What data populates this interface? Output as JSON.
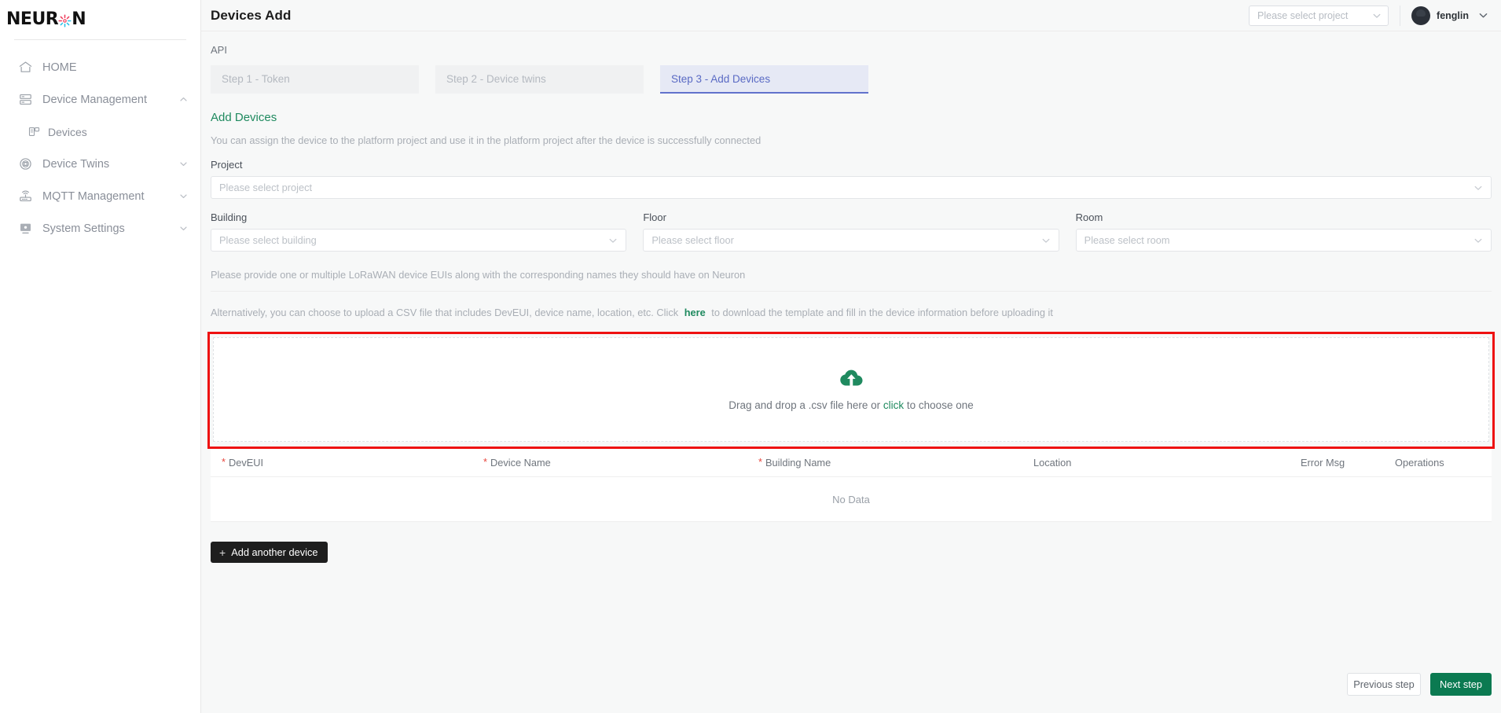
{
  "sidebar": {
    "logo_text_left": "NEUR",
    "logo_text_right": "N",
    "items": [
      {
        "label": "HOME",
        "icon": "home-icon",
        "expandable": false
      },
      {
        "label": "Device Management",
        "icon": "server-icon",
        "expandable": true,
        "state": "expanded"
      },
      {
        "label": "Devices",
        "icon": "devices-icon",
        "expandable": false,
        "sub": true
      },
      {
        "label": "Device Twins",
        "icon": "twins-icon",
        "expandable": true,
        "state": "collapsed"
      },
      {
        "label": "MQTT Management",
        "icon": "router-icon",
        "expandable": true,
        "state": "collapsed"
      },
      {
        "label": "System Settings",
        "icon": "monitor-icon",
        "expandable": true,
        "state": "collapsed"
      }
    ]
  },
  "topbar": {
    "title": "Devices Add",
    "project_select": {
      "value": "",
      "placeholder": "Please select project",
      "chevron": "chevron-down-icon"
    },
    "user": {
      "name": "fenglin",
      "avatar": "avatar",
      "chevron": "chevron-down-icon"
    }
  },
  "main": {
    "api_label": "API",
    "steps": [
      {
        "label": "Step 1 - Token",
        "active": false
      },
      {
        "label": "Step 2 - Device twins",
        "active": false
      },
      {
        "label": "Step 3 - Add Devices",
        "active": true
      }
    ],
    "section_title": "Add Devices",
    "section_desc": "You can assign the device to the platform project and use it in the platform project after the device is successfully connected",
    "fields": {
      "project": {
        "label": "Project",
        "placeholder": "Please select project",
        "value": ""
      },
      "building": {
        "label": "Building",
        "placeholder": "Please select building",
        "value": ""
      },
      "floor": {
        "label": "Floor",
        "placeholder": "Please select floor",
        "value": ""
      },
      "room": {
        "label": "Room",
        "placeholder": "Please select room",
        "value": ""
      }
    },
    "hint1": "Please provide one or multiple LoRaWAN device EUIs along with the corresponding names they should have on Neuron",
    "hint2_before": "Alternatively, you can choose to upload a CSV file that includes DevEUI, device name, location, etc. Click",
    "hint2_link": "here",
    "hint2_after": "to download the template and fill in the device information before uploading it",
    "dropzone": {
      "icon": "cloud-upload-icon",
      "text_before": "Drag and drop a .csv file here or",
      "text_link": "click",
      "text_after": "to choose one",
      "highlight_color": "#ee1111"
    },
    "table": {
      "columns": [
        {
          "label": "DevEUI",
          "required": true
        },
        {
          "label": "Device Name",
          "required": true
        },
        {
          "label": "Building Name",
          "required": true
        },
        {
          "label": "Location",
          "required": false
        },
        {
          "label": "Error Msg",
          "required": false
        },
        {
          "label": "Operations",
          "required": false
        }
      ],
      "empty_text": "No Data",
      "rows": []
    },
    "add_another_label": "Add another device",
    "add_another_icon": "plus-icon",
    "previous_label": "Previous step",
    "next_label": "Next step"
  },
  "colors": {
    "brand_green": "#1f8a5f",
    "next_button": "#0b7a51",
    "step_active_text": "#5a6ac4",
    "step_active_bg": "#e6e9f5",
    "required_star": "#e8453c",
    "highlight_red": "#ee1111"
  }
}
